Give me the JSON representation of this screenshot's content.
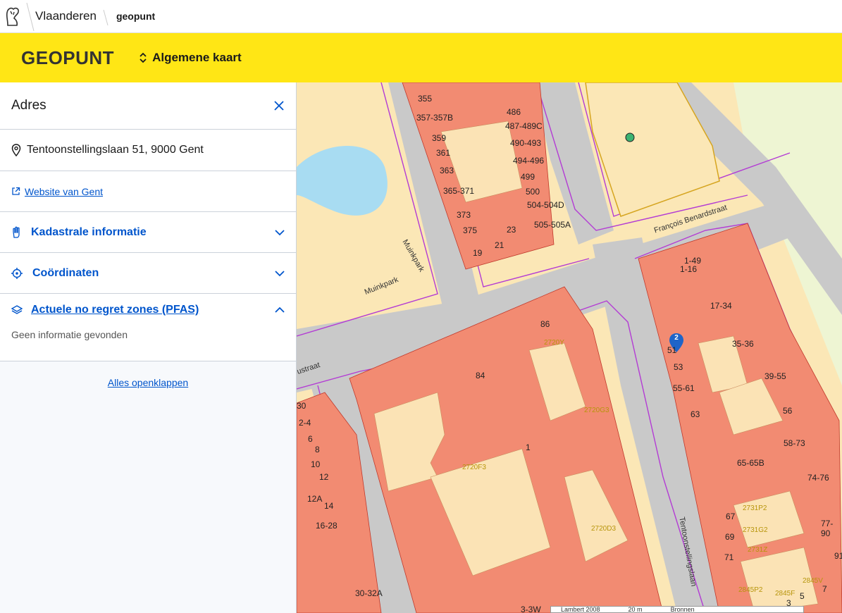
{
  "topbar": {
    "brand": "Vlaanderen",
    "crumb": "geopunt"
  },
  "appbar": {
    "title": "GEOPUNT",
    "map_switch": "Algemene kaart"
  },
  "panel": {
    "title": "Adres",
    "address": "Tentoonstellingslaan 51, 9000 Gent",
    "website_link": "Website van Gent",
    "sections": [
      {
        "label": "Kadastrale informatie"
      },
      {
        "label": "Coördinaten"
      },
      {
        "label": "Actuele no regret zones (PFAS)",
        "body": "Geen informatie gevonden"
      }
    ],
    "expand_all": "Alles openklappen"
  },
  "map": {
    "streets": [
      "Muinkpark",
      "Muinkpark",
      "François Benardstraat",
      "Tentoonstellingslaan",
      "ustraat"
    ],
    "parcels": [
      "355",
      "357-357B",
      "359",
      "361",
      "363",
      "365-371",
      "373",
      "375",
      "19",
      "21",
      "23",
      "486",
      "487-489C",
      "490-493",
      "494-496",
      "499",
      "500",
      "504-504D",
      "505-505A",
      "1-49",
      "1-16",
      "17-34",
      "35-36",
      "39-55",
      "56",
      "58-73",
      "74-76",
      "77-90",
      "65-65B",
      "63",
      "55-61",
      "53",
      "51",
      "67",
      "69",
      "71",
      "86",
      "84",
      "1",
      "30",
      "2-4",
      "6",
      "8",
      "10",
      "12",
      "12A",
      "14",
      "16-28",
      "30-32A",
      "3-3W",
      "91",
      "7",
      "5",
      "3",
      "1"
    ],
    "sections": [
      "2720Y",
      "2720G3",
      "2720F3",
      "2720D3",
      "2731P2",
      "2731G2",
      "2731Z",
      "2845P2",
      "2845F",
      "2845V"
    ],
    "marker": "2",
    "scale": "Lambert 2008",
    "scale_len": "20 m",
    "scale_extra": "Bronnen"
  }
}
